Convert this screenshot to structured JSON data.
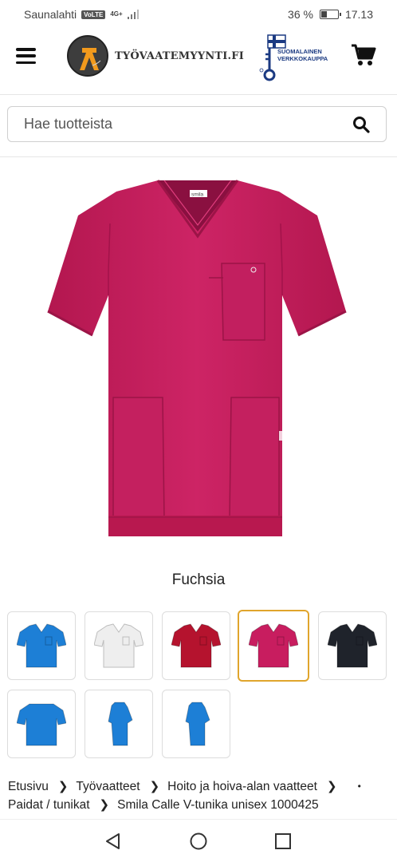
{
  "status_bar": {
    "carrier": "Saunalahti",
    "volte": "VoLTE",
    "network": "4G+",
    "battery_percent": "36 %",
    "battery_level": 0.36,
    "time": "17.13"
  },
  "header": {
    "logo_text": "TYÖVAATEMYYNTI.FI",
    "badge_line1": "SUOMALAINEN",
    "badge_line2": "VERKKOKAUPPA",
    "menu_icon": "hamburger-menu-icon",
    "cart_icon": "shopping-cart-icon"
  },
  "search": {
    "placeholder": "Hae tuotteista",
    "icon": "search-icon"
  },
  "product": {
    "color_name": "Fuchsia",
    "label_tag": "smila"
  },
  "swatches": [
    {
      "color": "#1d7fd6",
      "style": "front",
      "selected": false
    },
    {
      "color": "#eeeeee",
      "style": "front",
      "selected": false
    },
    {
      "color": "#b5132e",
      "style": "front",
      "selected": false
    },
    {
      "color": "#c81d5f",
      "style": "front",
      "selected": true
    },
    {
      "color": "#1f232b",
      "style": "front",
      "selected": false
    },
    {
      "color": "#1d7fd6",
      "style": "back",
      "selected": false
    },
    {
      "color": "#1d7fd6",
      "style": "side",
      "selected": false
    },
    {
      "color": "#1d7fd6",
      "style": "side",
      "selected": false
    }
  ],
  "breadcrumb": {
    "items": [
      "Etusivu",
      "Työvaatteet",
      "Hoito ja hoiva-alan vaatteet",
      "Paidat / tunikat",
      "Smila Calle V-tunika unisex 1000425"
    ],
    "dot": "•"
  },
  "colors": {
    "accent_selected": "#e0a52c",
    "product_fuchsia": "#c81d5f"
  }
}
